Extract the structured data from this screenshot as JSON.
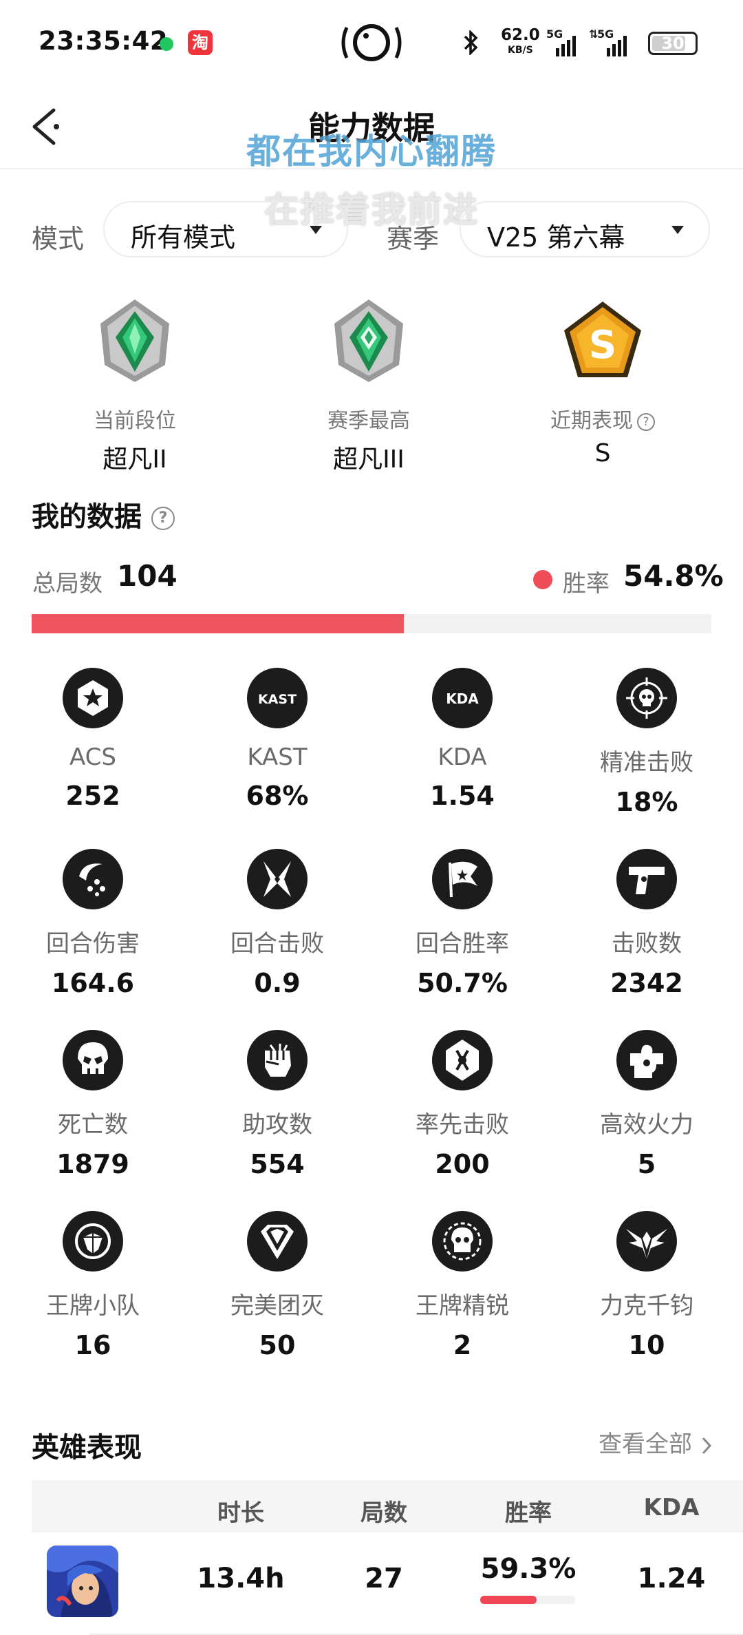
{
  "status_bar": {
    "time": "23:35:42",
    "app_badge": "淘",
    "net_speed": "62.0",
    "net_unit": "KB/S",
    "signal1": "5G",
    "signal2": "5G",
    "battery": "30"
  },
  "header": {
    "title": "能力数据",
    "overlay_line1": "都在我内心翻腾",
    "overlay_line2": "在推着我前进"
  },
  "filters": {
    "mode_label": "模式",
    "mode_value": "所有模式",
    "season_label": "赛季",
    "season_value": "V25 第六幕"
  },
  "ranks": [
    {
      "label": "当前段位",
      "value": "超凡II"
    },
    {
      "label": "赛季最高",
      "value": "超凡III"
    },
    {
      "label": "近期表现",
      "value": "S",
      "help": "?"
    }
  ],
  "my_data": {
    "title": "我的数据",
    "help": "?",
    "total_label": "总局数",
    "total_value": "104",
    "win_label": "胜率",
    "win_value": "54.8%",
    "win_rate_fraction": 0.548,
    "stats": [
      {
        "icon": "star-hexagon-icon",
        "label": "ACS",
        "value": "252"
      },
      {
        "icon": "kast-icon",
        "label": "KAST",
        "value": "68%",
        "icon_text": "KAST"
      },
      {
        "icon": "kda-icon",
        "label": "KDA",
        "value": "1.54",
        "icon_text": "KDA"
      },
      {
        "icon": "crosshair-skull-icon",
        "label": "精准击败",
        "value": "18%"
      },
      {
        "icon": "crescent-dots-icon",
        "label": "回合伤害",
        "value": "164.6"
      },
      {
        "icon": "crossed-blades-icon",
        "label": "回合击败",
        "value": "0.9"
      },
      {
        "icon": "flag-icon",
        "label": "回合胜率",
        "value": "50.7%"
      },
      {
        "icon": "pistol-icon",
        "label": "击败数",
        "value": "2342"
      },
      {
        "icon": "skull-icon",
        "label": "死亡数",
        "value": "1879"
      },
      {
        "icon": "fist-icon",
        "label": "助攻数",
        "value": "554"
      },
      {
        "icon": "first-strike-icon",
        "label": "率先击败",
        "value": "200"
      },
      {
        "icon": "puzzle-fire-icon",
        "label": "高效火力",
        "value": "5"
      },
      {
        "icon": "ace-squad-icon",
        "label": "王牌小队",
        "value": "16"
      },
      {
        "icon": "diamond-shield-icon",
        "label": "完美团灭",
        "value": "50"
      },
      {
        "icon": "elite-skull-icon",
        "label": "王牌精锐",
        "value": "2"
      },
      {
        "icon": "winged-icon",
        "label": "力克千钧",
        "value": "10"
      }
    ]
  },
  "hero_section": {
    "title": "英雄表现",
    "view_all": "查看全部",
    "columns": [
      "时长",
      "局数",
      "胜率",
      "KDA"
    ],
    "rows": [
      {
        "duration": "13.4h",
        "games": "27",
        "win_rate": "59.3%",
        "win_fraction": 0.593,
        "kda": "1.24"
      }
    ]
  },
  "colors": {
    "accent_red": "#ef5560",
    "overlay_blue": "#4fa3d6",
    "rank_green": "#1f9e5c",
    "gold": "#f0a020"
  }
}
